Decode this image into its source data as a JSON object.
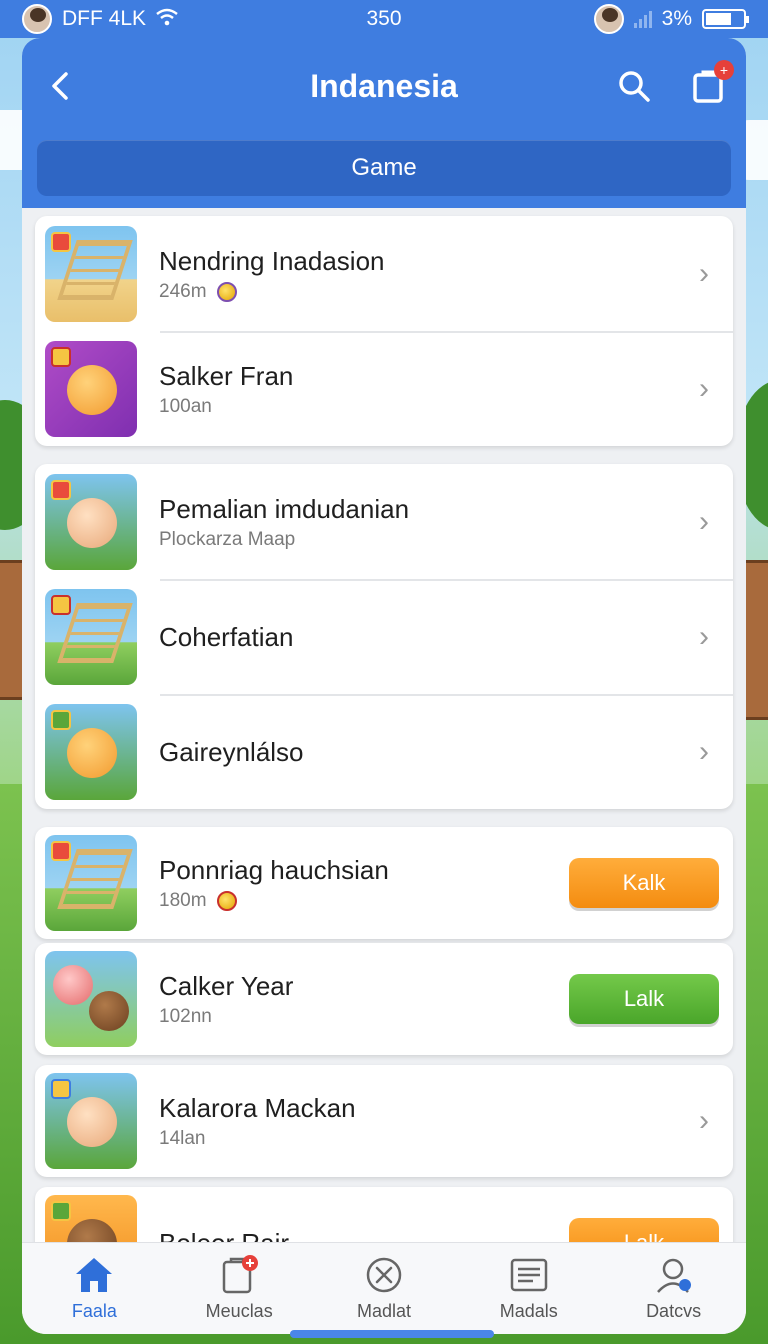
{
  "status_bar": {
    "left_text": "DFF 4LK",
    "time": "350",
    "battery_text": "3%"
  },
  "header": {
    "title": "Indanesia",
    "segment_label": "Game",
    "notification_badge": "+"
  },
  "colors": {
    "header_blue": "#3f7de0",
    "accent_orange": "#f48c10",
    "accent_green": "#4aa62a",
    "tab_active": "#2f6fd9"
  },
  "list": {
    "group1": [
      {
        "title": "Nendring Inadasion",
        "subtitle": "246m",
        "icon": "ladder-game-icon",
        "has_coin": true,
        "action": "chevron"
      },
      {
        "title": "Salker Fran",
        "subtitle": "100an",
        "icon": "smiley-game-icon",
        "has_coin": false,
        "action": "chevron"
      }
    ],
    "group2": [
      {
        "title": "Pemalian imdudanian",
        "subtitle": "Plockarza Maap",
        "icon": "character-game-icon",
        "action": "chevron"
      },
      {
        "title": "Coherfatian",
        "subtitle": "",
        "icon": "ladder-game-icon",
        "action": "chevron"
      },
      {
        "title": "Gaireynlálso",
        "subtitle": "",
        "icon": "smiley-game-icon",
        "action": "chevron"
      }
    ],
    "group3": [
      {
        "title": "Ponnriag hauchsian",
        "subtitle": "180m",
        "icon": "ladder-game-icon",
        "has_coin": true,
        "button_label": "Kalk"
      }
    ],
    "group4": [
      {
        "title": "Calker Year",
        "subtitle": "102nn",
        "icon": "critters-game-icon",
        "button_label": "Lalk"
      }
    ],
    "group5": [
      {
        "title": "Kalarora Mackan",
        "subtitle": "14lan",
        "icon": "character-game-icon",
        "action": "chevron"
      }
    ],
    "group6": [
      {
        "title": "Boleor Rair",
        "subtitle": "",
        "icon": "critter-game-icon",
        "button_label": "Lalk"
      }
    ]
  },
  "tabs": [
    {
      "label": "Faala",
      "icon": "home-icon",
      "active": true
    },
    {
      "label": "Meuclas",
      "icon": "clipboard-icon",
      "active": false
    },
    {
      "label": "Madlat",
      "icon": "close-circle-icon",
      "active": false
    },
    {
      "label": "Madals",
      "icon": "list-icon",
      "active": false
    },
    {
      "label": "Datcvs",
      "icon": "profile-icon",
      "active": false
    }
  ]
}
